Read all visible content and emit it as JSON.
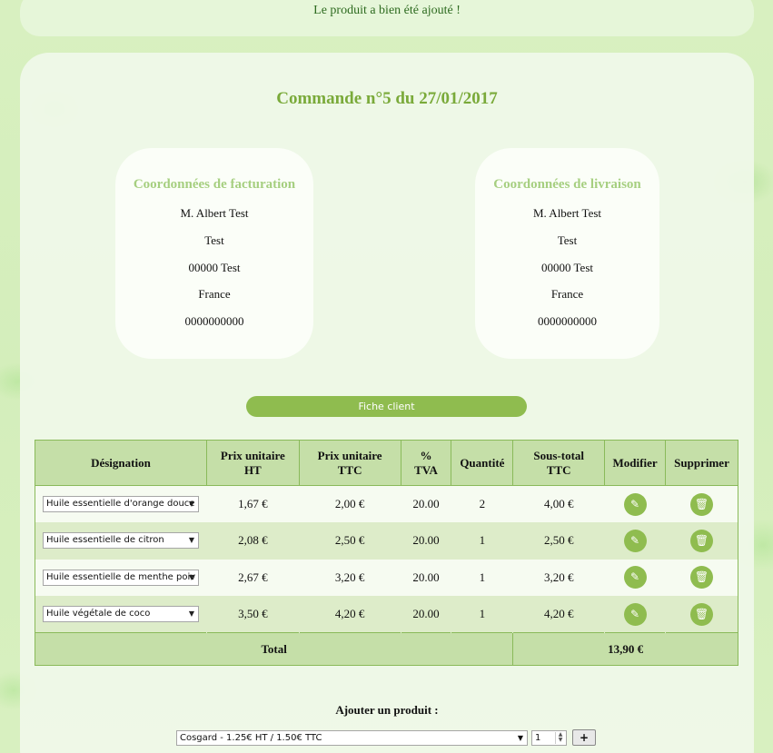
{
  "notice": "Le produit a bien été ajouté !",
  "title": "Commande n°5 du 27/01/2017",
  "billing": {
    "heading": "Coordonnées de facturation",
    "lines": [
      "M. Albert Test",
      "Test",
      "00000 Test",
      "France",
      "0000000000"
    ]
  },
  "shipping": {
    "heading": "Coordonnées de livraison",
    "lines": [
      "M. Albert Test",
      "Test",
      "00000 Test",
      "France",
      "0000000000"
    ]
  },
  "fiche_client": "Fiche client",
  "table": {
    "headers": {
      "designation": "Désignation",
      "prix_ht": [
        "Prix unitaire",
        "HT"
      ],
      "prix_ttc": [
        "Prix unitaire",
        "TTC"
      ],
      "tva": [
        "%",
        "TVA"
      ],
      "quantite": "Quantité",
      "sous_total": [
        "Sous-total",
        "TTC"
      ],
      "modifier": "Modifier",
      "supprimer": "Supprimer"
    },
    "rows": [
      {
        "designation": "Huile essentielle d'orange douce",
        "prix_ht": "1,67 €",
        "prix_ttc": "2,00 €",
        "tva": "20.00",
        "quantite": "2",
        "sous_total": "4,00 €"
      },
      {
        "designation": "Huile essentielle de citron",
        "prix_ht": "2,08 €",
        "prix_ttc": "2,50 €",
        "tva": "20.00",
        "quantite": "1",
        "sous_total": "2,50 €"
      },
      {
        "designation": "Huile essentielle de menthe poiv",
        "prix_ht": "2,67 €",
        "prix_ttc": "3,20 €",
        "tva": "20.00",
        "quantite": "1",
        "sous_total": "3,20 €"
      },
      {
        "designation": "Huile végétale de coco",
        "prix_ht": "3,50 €",
        "prix_ttc": "4,20 €",
        "tva": "20.00",
        "quantite": "1",
        "sous_total": "4,20 €"
      }
    ],
    "total_label": "Total",
    "total_value": "13,90 €"
  },
  "add_product": {
    "label": "Ajouter un produit :",
    "selected": "Cosgard - 1.25€ HT / 1.50€ TTC",
    "quantity": "1"
  },
  "icons": {
    "edit": "pencil-icon",
    "delete": "trash-icon",
    "dropdown": "chevron-down-icon",
    "add": "plus-icon"
  },
  "colors": {
    "accent": "#8fbc4f",
    "title": "#7aaa3a",
    "header_bg": "#c5dfa8"
  }
}
